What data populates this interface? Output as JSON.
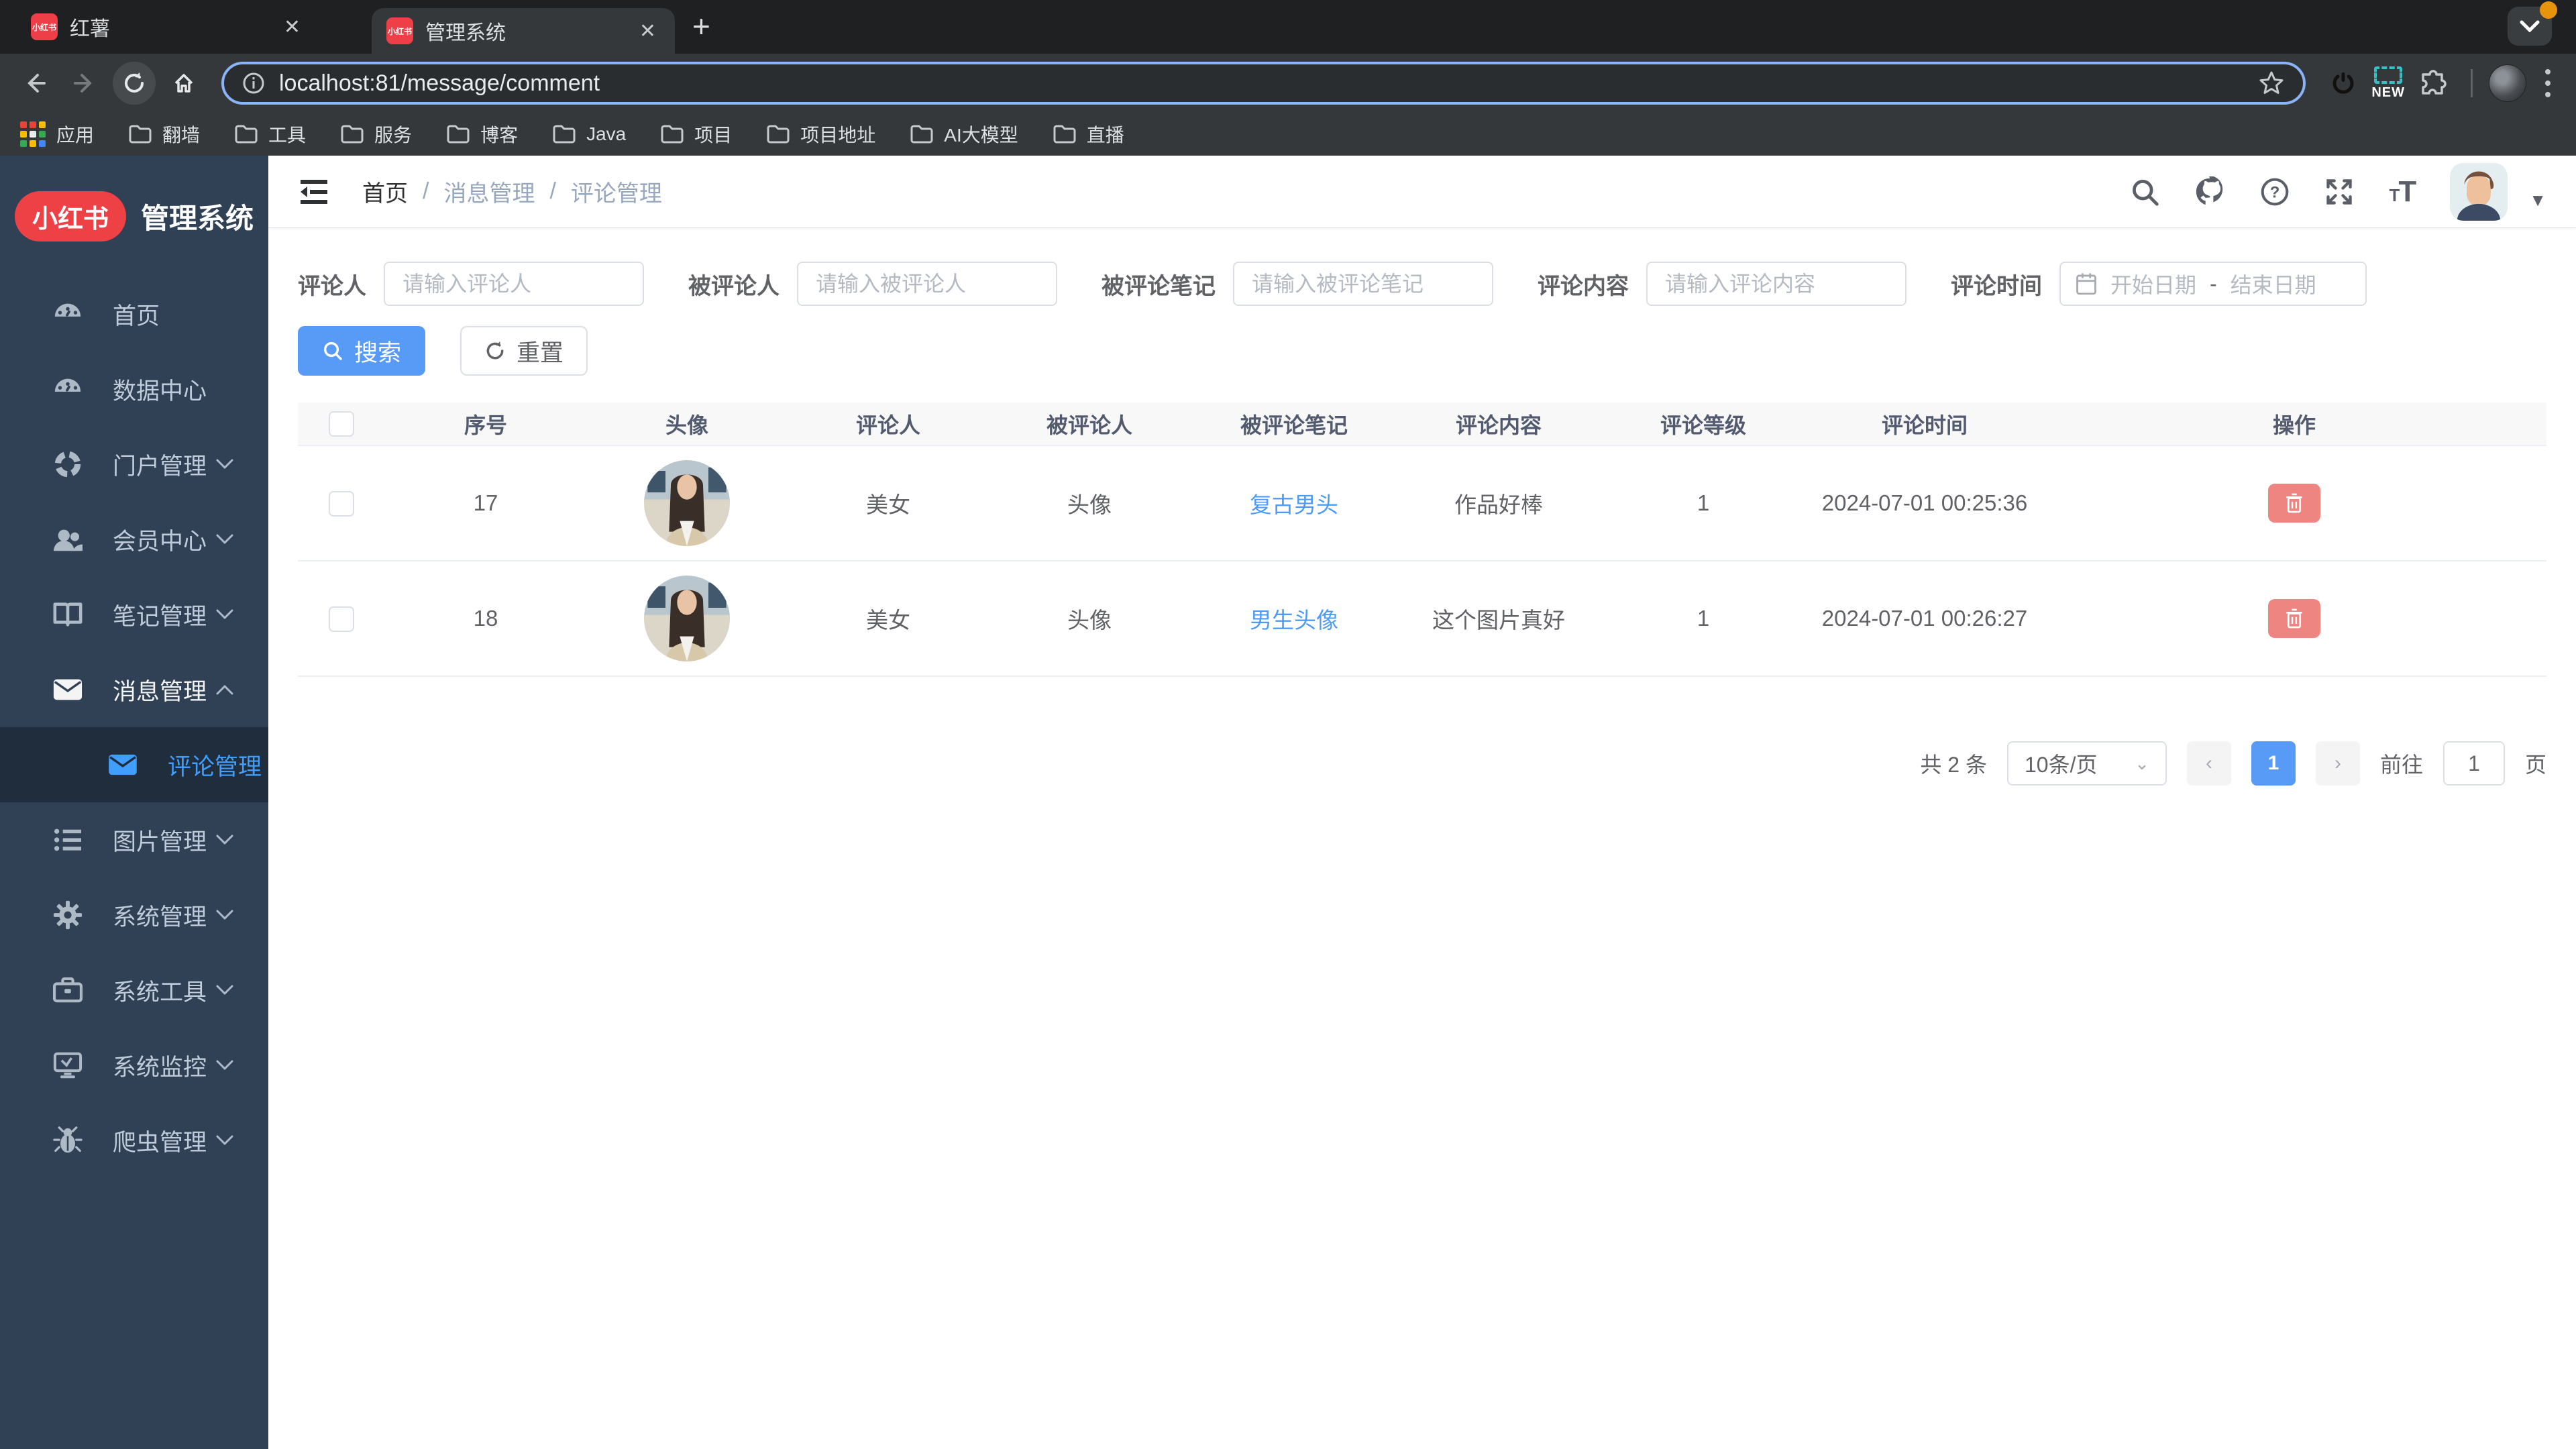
{
  "browser": {
    "tabs": [
      {
        "title": "红薯"
      },
      {
        "title": "管理系统"
      }
    ],
    "favicon_text": "小红书",
    "url": "localhost:81/message/comment",
    "new_badge": "NEW",
    "bookmarks": [
      "应用",
      "翻墙",
      "工具",
      "服务",
      "博客",
      "Java",
      "项目",
      "项目地址",
      "AI大模型",
      "直播"
    ]
  },
  "sidebar": {
    "logo": "小红书",
    "title": "管理系统",
    "items": [
      {
        "label": "首页"
      },
      {
        "label": "数据中心"
      },
      {
        "label": "门户管理"
      },
      {
        "label": "会员中心"
      },
      {
        "label": "笔记管理"
      },
      {
        "label": "消息管理"
      },
      {
        "label": "评论管理"
      },
      {
        "label": "图片管理"
      },
      {
        "label": "系统管理"
      },
      {
        "label": "系统工具"
      },
      {
        "label": "系统监控"
      },
      {
        "label": "爬虫管理"
      }
    ]
  },
  "breadcrumb": {
    "items": [
      "首页",
      "消息管理",
      "评论管理"
    ],
    "separator": "/"
  },
  "filters": {
    "commenter": {
      "label": "评论人",
      "placeholder": "请输入评论人"
    },
    "commented": {
      "label": "被评论人",
      "placeholder": "请输入被评论人"
    },
    "note": {
      "label": "被评论笔记",
      "placeholder": "请输入被评论笔记"
    },
    "content": {
      "label": "评论内容",
      "placeholder": "请输入评论内容"
    },
    "time": {
      "label": "评论时间",
      "start_placeholder": "开始日期",
      "separator": "-",
      "end_placeholder": "结束日期"
    }
  },
  "actions": {
    "search": "搜索",
    "reset": "重置"
  },
  "table": {
    "headers": {
      "seq": "序号",
      "avatar": "头像",
      "commenter": "评论人",
      "commented": "被评论人",
      "note": "被评论笔记",
      "content": "评论内容",
      "level": "评论等级",
      "time": "评论时间",
      "ops": "操作"
    },
    "rows": [
      {
        "seq": "17",
        "commenter": "美女",
        "commented": "头像",
        "note": "复古男头",
        "content": "作品好棒",
        "level": "1",
        "time": "2024-07-01 00:25:36"
      },
      {
        "seq": "18",
        "commenter": "美女",
        "commented": "头像",
        "note": "男生头像",
        "content": "这个图片真好",
        "level": "1",
        "time": "2024-07-01 00:26:27"
      }
    ]
  },
  "pagination": {
    "total": "共 2 条",
    "page_size": "10条/页",
    "current": "1",
    "goto_label": "前往",
    "goto_value": "1",
    "page_label": "页"
  },
  "colors": {
    "accent": "#579bf7",
    "link": "#4e9af5",
    "danger": "#ee8580",
    "sidebar_bg": "#304156",
    "sidebar_active_bg": "#1f2d3d",
    "active_menu_text": "#409eff",
    "logo_red": "#ee4146",
    "omnibox_focus": "#8ab4f8"
  }
}
